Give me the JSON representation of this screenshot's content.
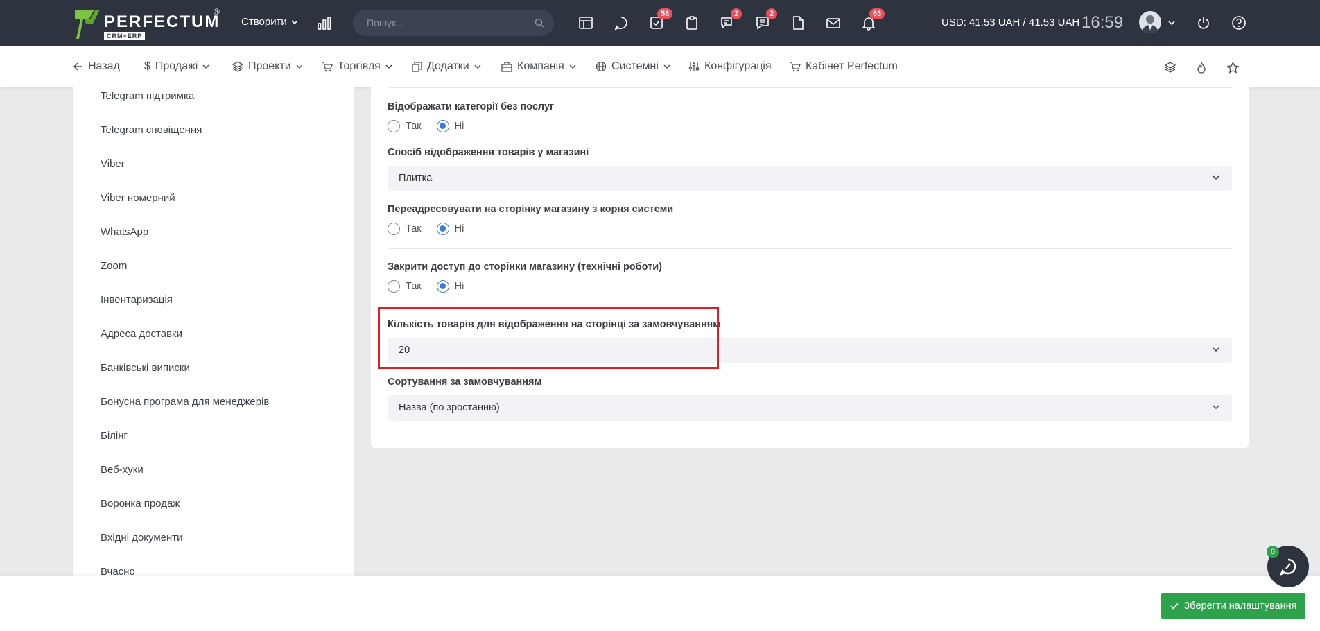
{
  "header": {
    "logo_text": "PERFECTUM",
    "logo_reg": "®",
    "logo_sub": "CRM+ERP",
    "create_label": "Створити",
    "search_placeholder": "Пошук...",
    "badges": {
      "tasks": "58",
      "chat": "2",
      "messages": "2",
      "notifications": "63"
    },
    "currency": "USD: 41.53 UAH / 41.53 UAH",
    "time": "16:59"
  },
  "nav": {
    "back": "Назад",
    "sales": "Продажі",
    "projects": "Проекти",
    "trade": "Торгівля",
    "addons": "Додатки",
    "company": "Компанія",
    "system": "Системні",
    "config": "Конфігурація",
    "cabinet": "Кабінет Perfectum"
  },
  "sidebar": {
    "items": [
      "Telegram підтримка",
      "Telegram сповіщення",
      "Viber",
      "Viber номерний",
      "WhatsApp",
      "Zoom",
      "Інвентаризація",
      "Адреса доставки",
      "Банківські виписки",
      "Бонусна програма для менеджерів",
      "Білінг",
      "Веб-хуки",
      "Воронка продаж",
      "Вхідні документи",
      "Вчасно"
    ]
  },
  "settings": {
    "yes": "Так",
    "no": "Ні",
    "show_empty_categories": {
      "label": "Відображати категорії без послуг",
      "value": "no"
    },
    "display_mode": {
      "label": "Спосіб відображення товарів у магазині",
      "value": "Плитка"
    },
    "redirect_root": {
      "label": "Переадресовувати на сторінку магазину з корня системи",
      "value": "no"
    },
    "close_access": {
      "label": "Закрити доступ до сторінки магазину (технічні роботи)",
      "value": "no"
    },
    "items_per_page": {
      "label": "Кількість товарів для відображення на сторінці за замовчуванням",
      "value": "20"
    },
    "default_sort": {
      "label": "Сортування за замовчуванням",
      "value": "Назва (по зростанню)"
    }
  },
  "footer": {
    "save_label": "Зберегти налаштування",
    "chat_count": "0"
  },
  "colors": {
    "topbar": "#2d3440",
    "accent": "#3b7ddd",
    "save": "#2ea14b",
    "highlight": "#e01e27",
    "badge": "#e7515a"
  }
}
